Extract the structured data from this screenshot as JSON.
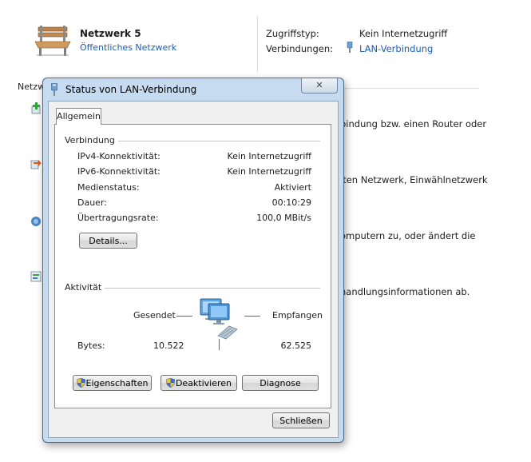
{
  "network": {
    "name": "Netzwerk  5",
    "type": "Öffentliches Netzwerk",
    "access_label": "Zugriffstyp:",
    "access_value": "Kein Internetzugriff",
    "connections_label": "Verbindungen:",
    "connections_value": "LAN-Verbindung"
  },
  "background": {
    "left_fragment": "Netzw",
    "task1_fragment": "bindung bzw. einen Router oder",
    "task2_fragment": "lten Netzwerk, Einwählnetzwerk",
    "task3_fragment": "omputern zu, oder ändert die",
    "task4_fragment": "handlungsinformationen ab."
  },
  "dialog": {
    "title": "Status von LAN-Verbindung",
    "close_glyph": "✕",
    "tab_label": "Allgemein",
    "connection_group": "Verbindung",
    "rows": [
      {
        "label": "IPv4-Konnektivität:",
        "value": "Kein Internetzugriff"
      },
      {
        "label": "IPv6-Konnektivität:",
        "value": "Kein Internetzugriff"
      },
      {
        "label": "Medienstatus:",
        "value": "Aktiviert"
      },
      {
        "label": "Dauer:",
        "value": "00:10:29"
      },
      {
        "label": "Übertragungsrate:",
        "value": "100,0 MBit/s"
      }
    ],
    "details_button": "Details...",
    "activity_group": "Aktivität",
    "sent_label": "Gesendet",
    "received_label": "Empfangen",
    "bytes_label": "Bytes:",
    "bytes_sent": "10.522",
    "bytes_received": "62.525",
    "properties_button": "Eigenschaften",
    "deactivate_button": "Deaktivieren",
    "diagnose_button": "Diagnose",
    "close_button": "Schließen"
  },
  "colors": {
    "link": "#1a5fb4",
    "dialog_frame": "#c6dbef"
  }
}
